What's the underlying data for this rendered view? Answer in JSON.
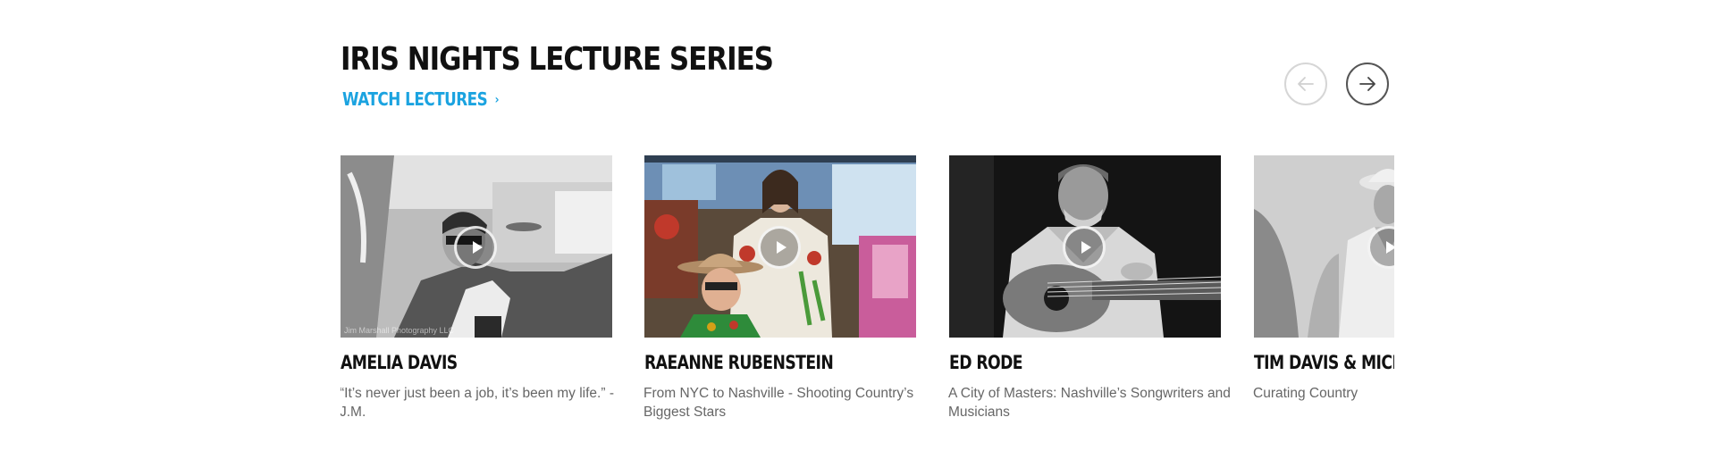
{
  "section": {
    "title": "IRIS NIGHTS LECTURE SERIES",
    "watch_link": "WATCH LECTURES",
    "link_color": "#1ba3e0"
  },
  "nav": {
    "prev_icon": "arrow-left-icon",
    "next_icon": "arrow-right-icon"
  },
  "cards": [
    {
      "name": "AMELIA DAVIS",
      "description": "“It’s never just been a job, it’s been my life.” -J.M.",
      "credit": "Jim Marshall Photography LLC",
      "icon": "play-icon"
    },
    {
      "name": "RAEANNE RUBENSTEIN",
      "description": "From NYC to Nashville - Shooting Country’s Biggest Stars",
      "icon": "play-icon"
    },
    {
      "name": "ED RODE",
      "description": "A City of Masters: Nashville’s Songwriters and Musicians",
      "icon": "play-icon"
    },
    {
      "name": "TIM DAVIS & MICHAEL",
      "description": "Curating Country",
      "icon": "play-icon"
    }
  ]
}
